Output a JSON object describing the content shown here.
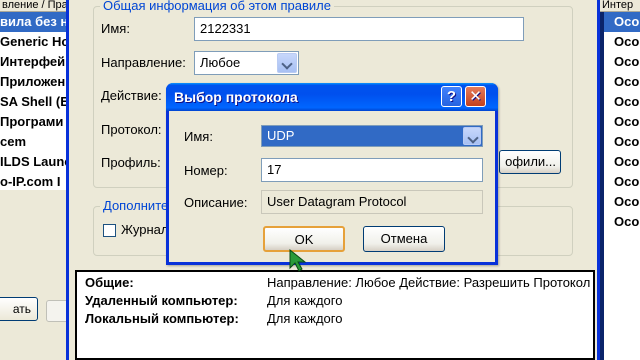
{
  "bg_left": {
    "header": "вление / Прав",
    "rows": [
      {
        "label": "вила без н",
        "selected": true
      },
      {
        "label": "Generic Ho",
        "selected": false
      },
      {
        "label": "Интерфей",
        "selected": false
      },
      {
        "label": "Приложен",
        "selected": false
      },
      {
        "label": "SA Shell (E",
        "selected": false
      },
      {
        "label": "Програми",
        "selected": false
      },
      {
        "label": "cem",
        "selected": false
      },
      {
        "label": "ILDS Launc",
        "selected": false
      },
      {
        "label": "o-IP.com I",
        "selected": false
      }
    ],
    "button_label": "ать"
  },
  "bg_right": {
    "header": "Интер",
    "rows": [
      {
        "label": "Осо",
        "selected": true
      },
      {
        "label": "Осо",
        "selected": false
      },
      {
        "label": "Осо",
        "selected": false
      },
      {
        "label": "Осо",
        "selected": false
      },
      {
        "label": "Осо",
        "selected": false
      },
      {
        "label": "Осо",
        "selected": false
      },
      {
        "label": "Осо",
        "selected": false
      },
      {
        "label": "Осо",
        "selected": false
      },
      {
        "label": "Осо",
        "selected": false
      },
      {
        "label": "Осо",
        "selected": false
      },
      {
        "label": "Осо",
        "selected": false
      }
    ]
  },
  "props": {
    "group_general": "Общая информация об этом правиле",
    "name_label": "Имя:",
    "name_value": "2122331",
    "direction_label": "Направление:",
    "direction_value": "Любое",
    "action_label": "Действие:",
    "protocol_label": "Протокол:",
    "profile_label": "Профиль:",
    "profiles_button": "офили...",
    "group_additional": "Дополните",
    "journal_label": "Журнал"
  },
  "summary": {
    "rows": [
      {
        "key": "Общие:",
        "value": "Направление: Любое   Действие: Разрешить   Протокол"
      },
      {
        "key": "Удаленный компьютер:",
        "value": "Для каждого"
      },
      {
        "key": "Локальный компьютер:",
        "value": "Для каждого"
      }
    ]
  },
  "dialog": {
    "title": "Выбор протокола",
    "help_glyph": "?",
    "close_glyph": "✕",
    "name_label": "Имя:",
    "name_value": "UDP",
    "number_label": "Номер:",
    "number_value": "17",
    "description_label": "Описание:",
    "description_value": "User Datagram Protocol",
    "ok_label": "OK",
    "cancel_label": "Отмена"
  },
  "colors": {
    "selection": "#316ac5",
    "title_bar": "#0053ee",
    "groupbox_title": "#0046d5",
    "cursor": "#2a9a3a"
  },
  "icons": {
    "cursor": "arrow-pointer-icon",
    "help": "question-icon",
    "close": "close-icon",
    "dropdown": "chevron-down-icon"
  }
}
